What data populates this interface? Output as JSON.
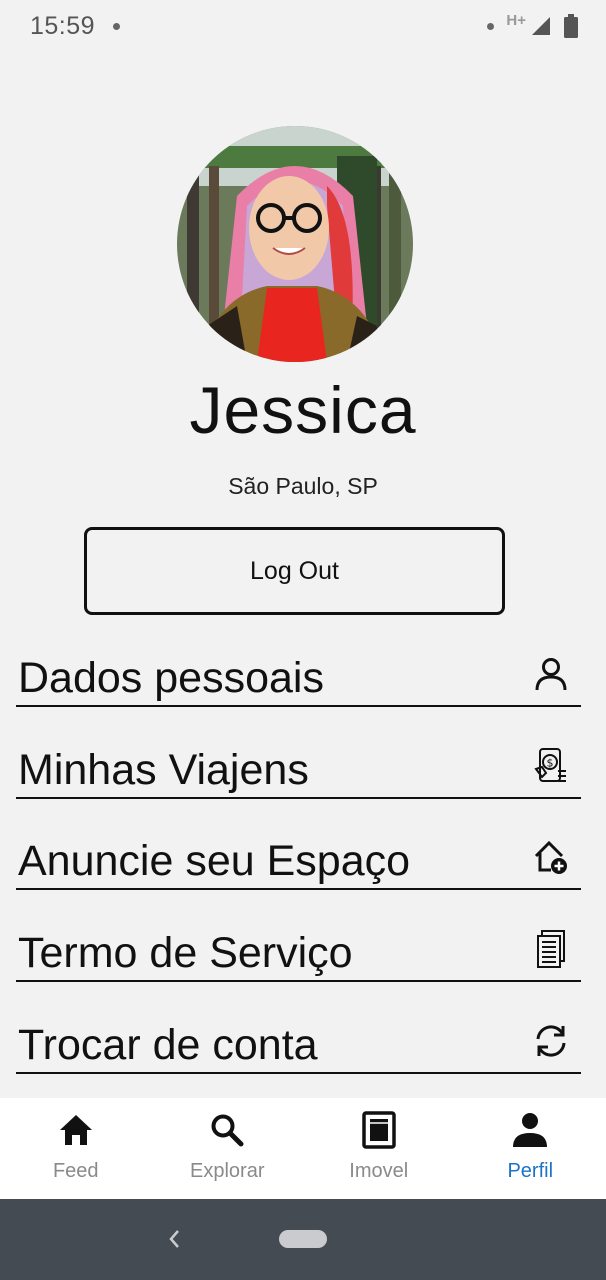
{
  "status_bar": {
    "time": "15:59",
    "network": "H+"
  },
  "profile": {
    "name": "Jessica",
    "location": "São Paulo, SP"
  },
  "logout_label": "Log Out",
  "menu": [
    {
      "label": "Dados pessoais",
      "icon": "person-icon"
    },
    {
      "label": "Minhas Viajens",
      "icon": "phone-money-icon"
    },
    {
      "label": "Anuncie seu Espaço",
      "icon": "house-add-icon"
    },
    {
      "label": "Termo de Serviço",
      "icon": "document-icon"
    },
    {
      "label": "Trocar de conta",
      "icon": "refresh-icon"
    }
  ],
  "bottom_nav": [
    {
      "label": "Feed",
      "icon": "home-icon",
      "active": false
    },
    {
      "label": "Explorar",
      "icon": "search-icon",
      "active": false
    },
    {
      "label": "Imovel",
      "icon": "building-icon",
      "active": false
    },
    {
      "label": "Perfil",
      "icon": "person-icon",
      "active": true
    }
  ],
  "colors": {
    "background": "#f2f2f2",
    "accent": "#1a73c9",
    "system_nav": "#454b53"
  }
}
